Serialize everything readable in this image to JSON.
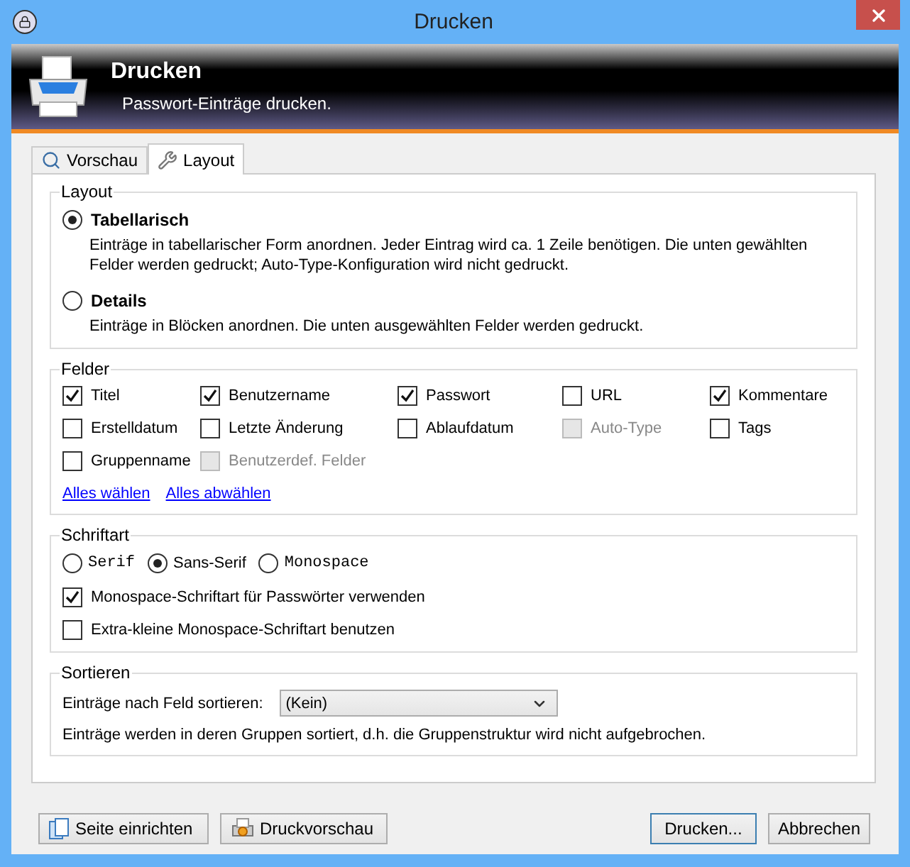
{
  "window": {
    "title": "Drucken"
  },
  "banner": {
    "title": "Drucken",
    "subtitle": "Passwort-Einträge drucken."
  },
  "tabs": [
    {
      "label": "Vorschau",
      "kind": "preview",
      "selected": false
    },
    {
      "label": "Layout",
      "kind": "layout",
      "selected": true
    }
  ],
  "layout_group": {
    "title": "Layout",
    "options": [
      {
        "label": "Tabellarisch",
        "description": "Einträge in tabellarischer Form anordnen. Jeder Eintrag wird ca. 1 Zeile benötigen. Die unten gewählten Felder werden gedruckt; Auto-Type-Konfiguration wird nicht gedruckt.",
        "selected": true
      },
      {
        "label": "Details",
        "description": "Einträge in Blöcken anordnen. Die unten ausgewählten Felder werden gedruckt.",
        "selected": false
      }
    ]
  },
  "fields_group": {
    "title": "Felder",
    "fields": [
      {
        "label": "Titel",
        "checked": true,
        "disabled": false
      },
      {
        "label": "Benutzername",
        "checked": true,
        "disabled": false
      },
      {
        "label": "Passwort",
        "checked": true,
        "disabled": false
      },
      {
        "label": "URL",
        "checked": false,
        "disabled": false
      },
      {
        "label": "Kommentare",
        "checked": true,
        "disabled": false
      },
      {
        "label": "Erstelldatum",
        "checked": false,
        "disabled": false
      },
      {
        "label": "Letzte Änderung",
        "checked": false,
        "disabled": false
      },
      {
        "label": "Ablaufdatum",
        "checked": false,
        "disabled": false
      },
      {
        "label": "Auto-Type",
        "checked": false,
        "disabled": true
      },
      {
        "label": "Tags",
        "checked": false,
        "disabled": false
      },
      {
        "label": "Gruppenname",
        "checked": false,
        "disabled": false
      },
      {
        "label": "Benutzerdef. Felder",
        "checked": false,
        "disabled": true
      }
    ],
    "links": [
      "Alles wählen",
      "Alles abwählen"
    ]
  },
  "font_group": {
    "title": "Schriftart",
    "fonts": [
      {
        "label": "Serif",
        "kind": "mono",
        "selected": false
      },
      {
        "label": "Sans-Serif",
        "kind": "sans",
        "selected": true
      },
      {
        "label": "Monospace",
        "kind": "mono",
        "selected": false
      }
    ],
    "options": [
      {
        "label": "Monospace-Schriftart für Passwörter verwenden",
        "checked": true
      },
      {
        "label": "Extra-kleine Monospace-Schriftart benutzen",
        "checked": false
      }
    ]
  },
  "sort_group": {
    "title": "Sortieren",
    "label": "Einträge nach Feld sortieren:",
    "value": "(Kein)",
    "note": "Einträge werden in deren Gruppen sortiert, d.h. die Gruppenstruktur wird nicht aufgebrochen."
  },
  "buttons_left": [
    {
      "label": "Seite einrichten",
      "kind": "page"
    },
    {
      "label": "Druckvorschau",
      "kind": "preview"
    }
  ],
  "buttons_right": [
    {
      "label": "Drucken...",
      "default": true
    },
    {
      "label": "Abbrechen",
      "default": false
    }
  ]
}
